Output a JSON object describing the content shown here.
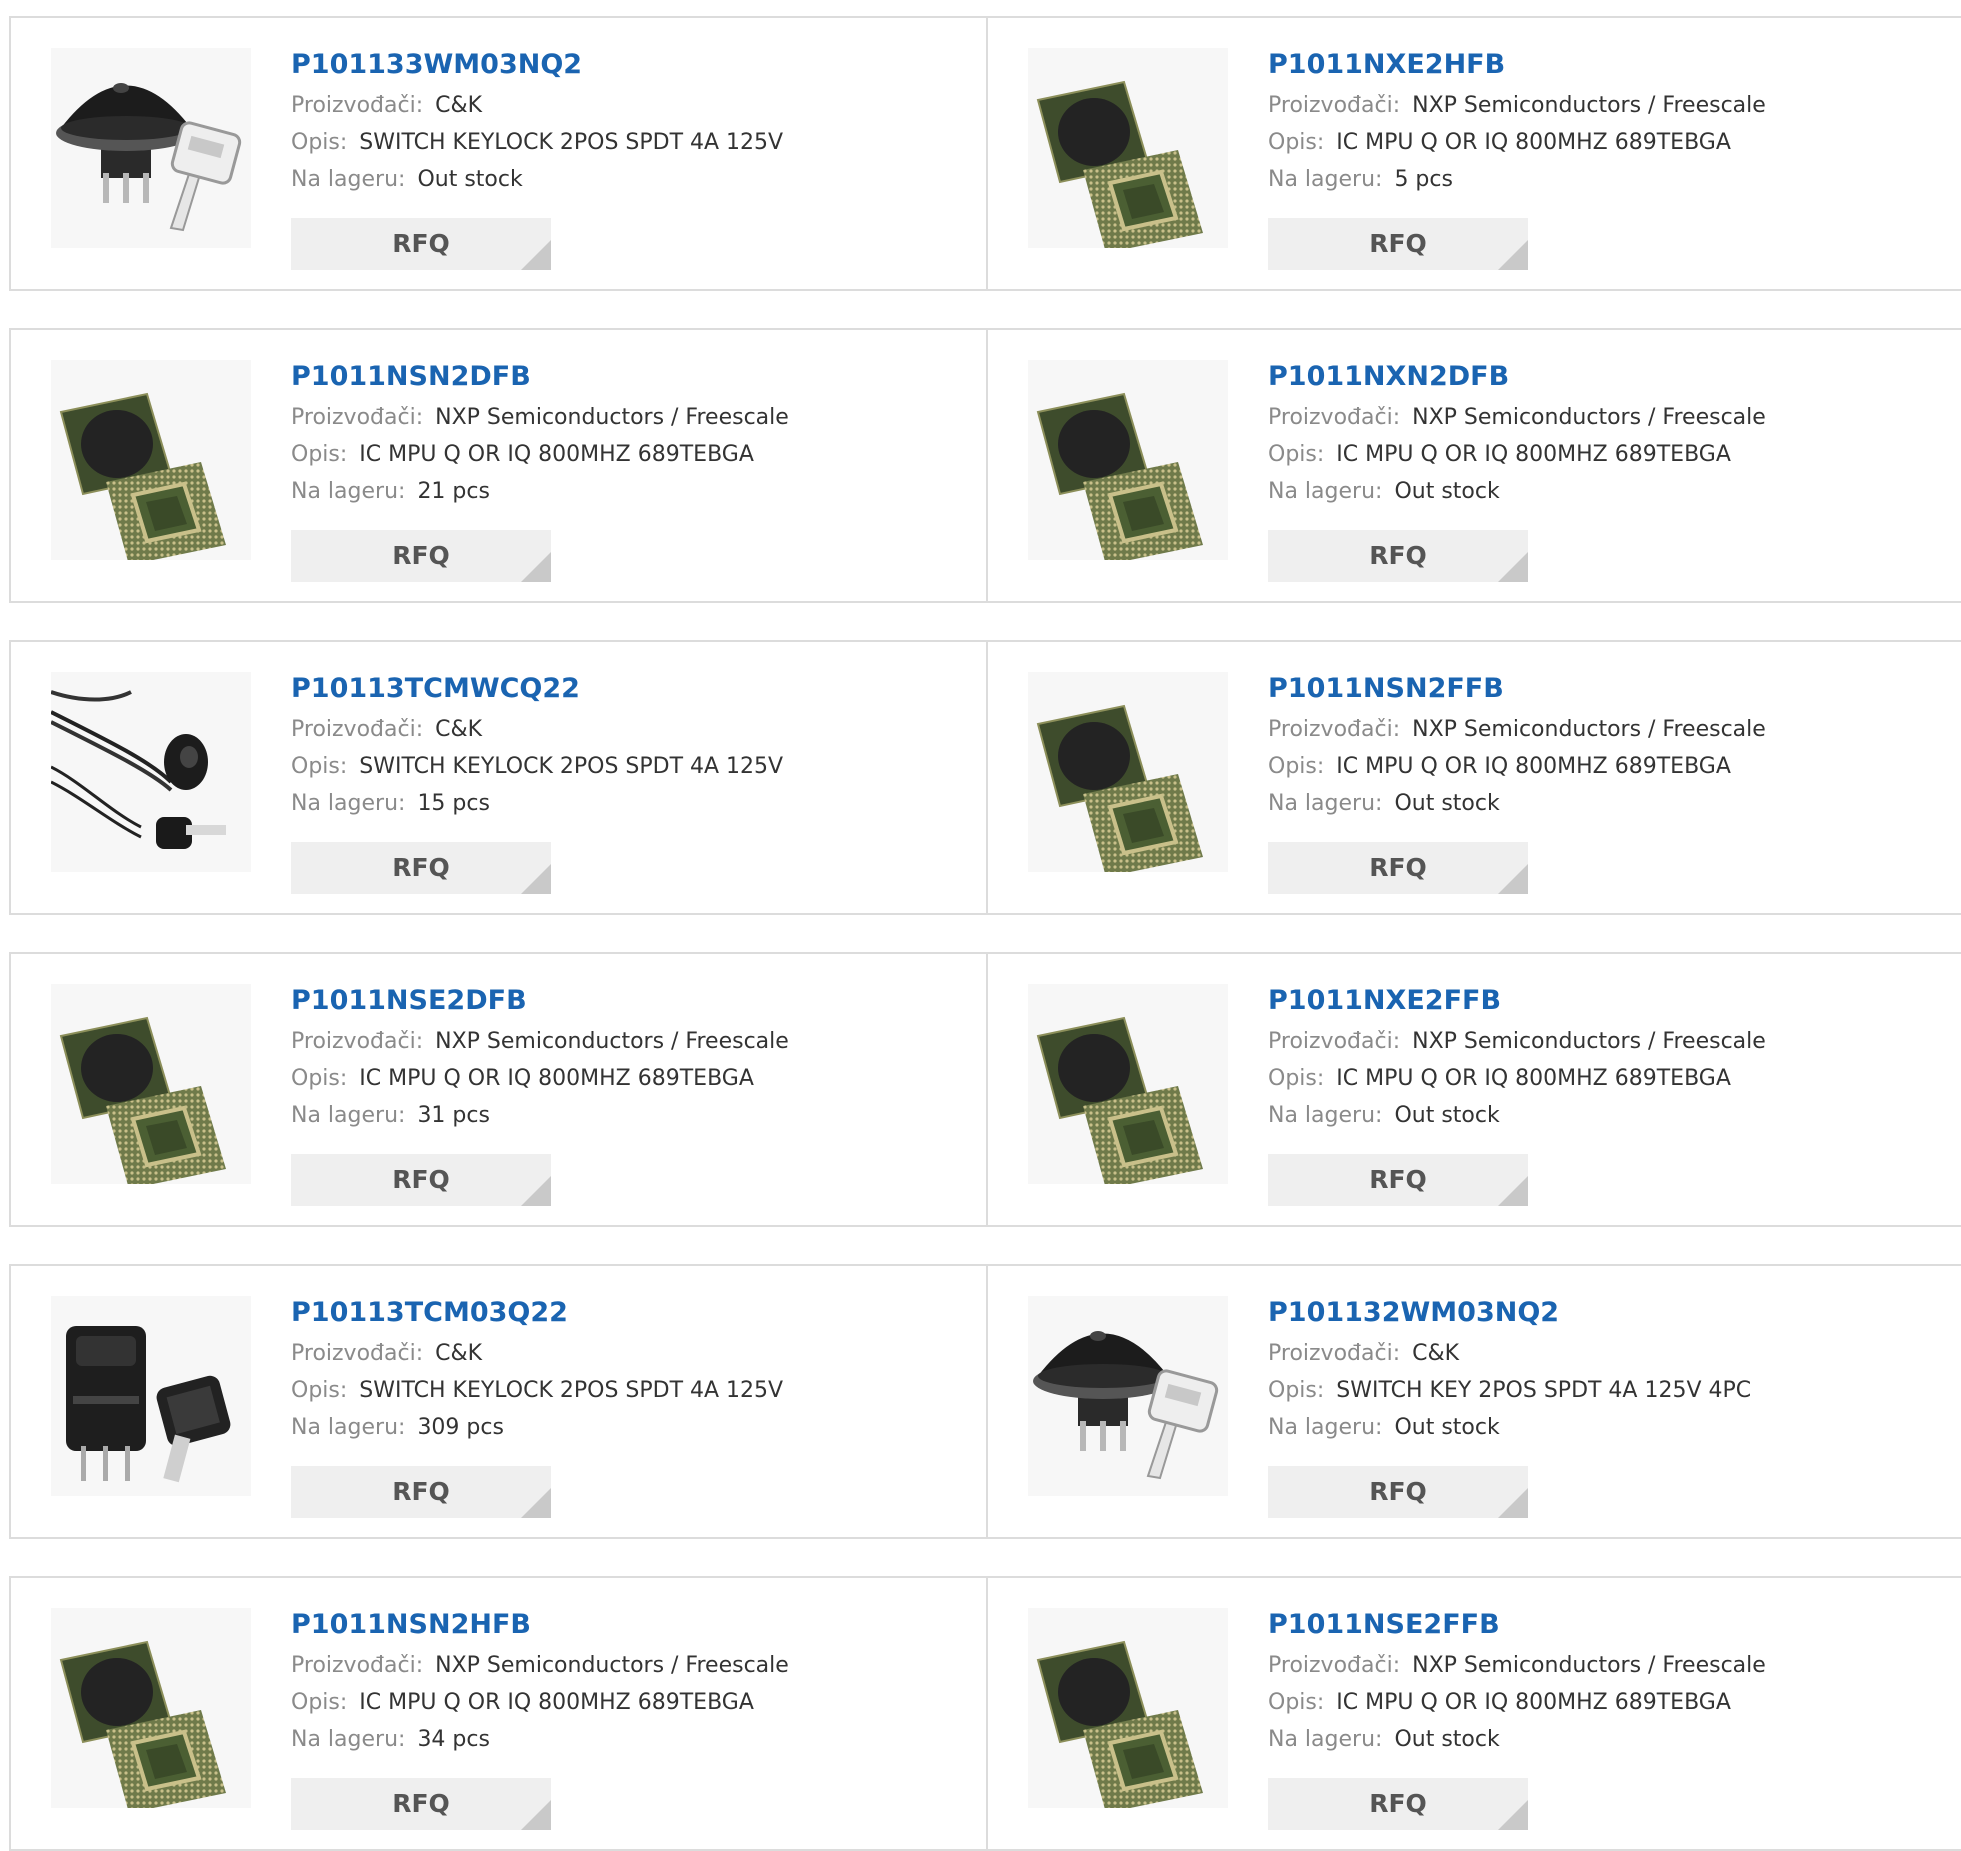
{
  "labels": {
    "manufacturer": "Proizvođači:",
    "description": "Opis:",
    "stock": "Na lageru:",
    "rfq": "RFQ"
  },
  "products": [
    {
      "pn": "P101133WM03NQ2",
      "mfr": "C&K",
      "desc": "SWITCH KEYLOCK 2POS SPDT 4A 125V",
      "stock": "Out stock",
      "image": "keylock-switch-round"
    },
    {
      "pn": "P1011NXE2HFB",
      "mfr": "NXP Semiconductors / Freescale",
      "desc": "IC MPU Q OR IQ 800MHZ 689TEBGA",
      "stock": "5 pcs",
      "image": "bga-chip"
    },
    {
      "pn": "P1011NSN2DFB",
      "mfr": "NXP Semiconductors / Freescale",
      "desc": "IC MPU Q OR IQ 800MHZ 689TEBGA",
      "stock": "21 pcs",
      "image": "bga-chip"
    },
    {
      "pn": "P1011NXN2DFB",
      "mfr": "NXP Semiconductors / Freescale",
      "desc": "IC MPU Q OR IQ 800MHZ 689TEBGA",
      "stock": "Out stock",
      "image": "bga-chip"
    },
    {
      "pn": "P10113TCMWCQ22",
      "mfr": "C&K",
      "desc": "SWITCH KEYLOCK 2POS SPDT 4A 125V",
      "stock": "15 pcs",
      "image": "keylock-switch-wired"
    },
    {
      "pn": "P1011NSN2FFB",
      "mfr": "NXP Semiconductors / Freescale",
      "desc": "IC MPU Q OR IQ 800MHZ 689TEBGA",
      "stock": "Out stock",
      "image": "bga-chip"
    },
    {
      "pn": "P1011NSE2DFB",
      "mfr": "NXP Semiconductors / Freescale",
      "desc": "IC MPU Q OR IQ 800MHZ 689TEBGA",
      "stock": "31 pcs",
      "image": "bga-chip"
    },
    {
      "pn": "P1011NXE2FFB",
      "mfr": "NXP Semiconductors / Freescale",
      "desc": "IC MPU Q OR IQ 800MHZ 689TEBGA",
      "stock": "Out stock",
      "image": "bga-chip"
    },
    {
      "pn": "P10113TCM03Q22",
      "mfr": "C&K",
      "desc": "SWITCH KEYLOCK 2POS SPDT 4A 125V",
      "stock": "309 pcs",
      "image": "keylock-switch-square"
    },
    {
      "pn": "P101132WM03NQ2",
      "mfr": "C&K",
      "desc": "SWITCH KEY 2POS SPDT 4A 125V 4PC",
      "stock": "Out stock",
      "image": "keylock-switch-round"
    },
    {
      "pn": "P1011NSN2HFB",
      "mfr": "NXP Semiconductors / Freescale",
      "desc": "IC MPU Q OR IQ 800MHZ 689TEBGA",
      "stock": "34 pcs",
      "image": "bga-chip"
    },
    {
      "pn": "P1011NSE2FFB",
      "mfr": "NXP Semiconductors / Freescale",
      "desc": "IC MPU Q OR IQ 800MHZ 689TEBGA",
      "stock": "Out stock",
      "image": "bga-chip"
    }
  ],
  "colors": {
    "link": "#1a64b1",
    "label": "#8a8a8a",
    "value": "#333333",
    "border": "#dcdcdc",
    "button_bg": "#efefef"
  }
}
